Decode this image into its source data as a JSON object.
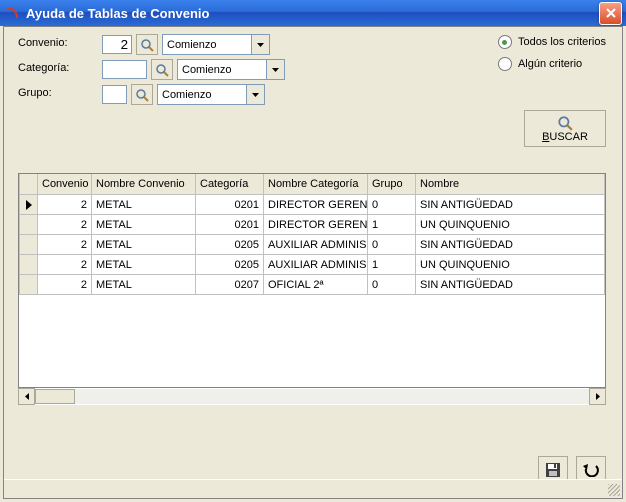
{
  "window": {
    "title": "Ayuda de Tablas de Convenio"
  },
  "labels": {
    "convenio": "Convenio:",
    "categoria": "Categoría:",
    "grupo": "Grupo:"
  },
  "inputs": {
    "convenio_value": "2",
    "categoria_value": "",
    "grupo_value": ""
  },
  "combos": {
    "convenio": "Comienzo",
    "categoria": "Comienzo",
    "grupo": "Comienzo"
  },
  "radios": {
    "all_label": "Todos los criterios",
    "any_label": "Algún criterio",
    "selected": "all"
  },
  "buscar": {
    "label": "BUSCAR",
    "underline_pos": 0
  },
  "grid": {
    "headers": [
      "Convenio",
      "Nombre Convenio",
      "Categoría",
      "Nombre Categoría",
      "Grupo",
      "Nombre"
    ],
    "rows": [
      {
        "sel": true,
        "convenio": "2",
        "nombre_convenio": "METAL",
        "categoria": "0201",
        "nombre_categoria": "DIRECTOR GEREN",
        "grupo": "0",
        "nombre": "SIN ANTIGÜEDAD"
      },
      {
        "sel": false,
        "convenio": "2",
        "nombre_convenio": "METAL",
        "categoria": "0201",
        "nombre_categoria": "DIRECTOR GEREN",
        "grupo": "1",
        "nombre": "UN QUINQUENIO"
      },
      {
        "sel": false,
        "convenio": "2",
        "nombre_convenio": "METAL",
        "categoria": "0205",
        "nombre_categoria": "AUXILIAR ADMINIS",
        "grupo": "0",
        "nombre": "SIN ANTIGÜEDAD"
      },
      {
        "sel": false,
        "convenio": "2",
        "nombre_convenio": "METAL",
        "categoria": "0205",
        "nombre_categoria": "AUXILIAR ADMINIS",
        "grupo": "1",
        "nombre": "UN QUINQUENIO"
      },
      {
        "sel": false,
        "convenio": "2",
        "nombre_convenio": "METAL",
        "categoria": "0207",
        "nombre_categoria": "OFICIAL 2ª",
        "grupo": "0",
        "nombre": "SIN ANTIGÜEDAD"
      }
    ]
  }
}
